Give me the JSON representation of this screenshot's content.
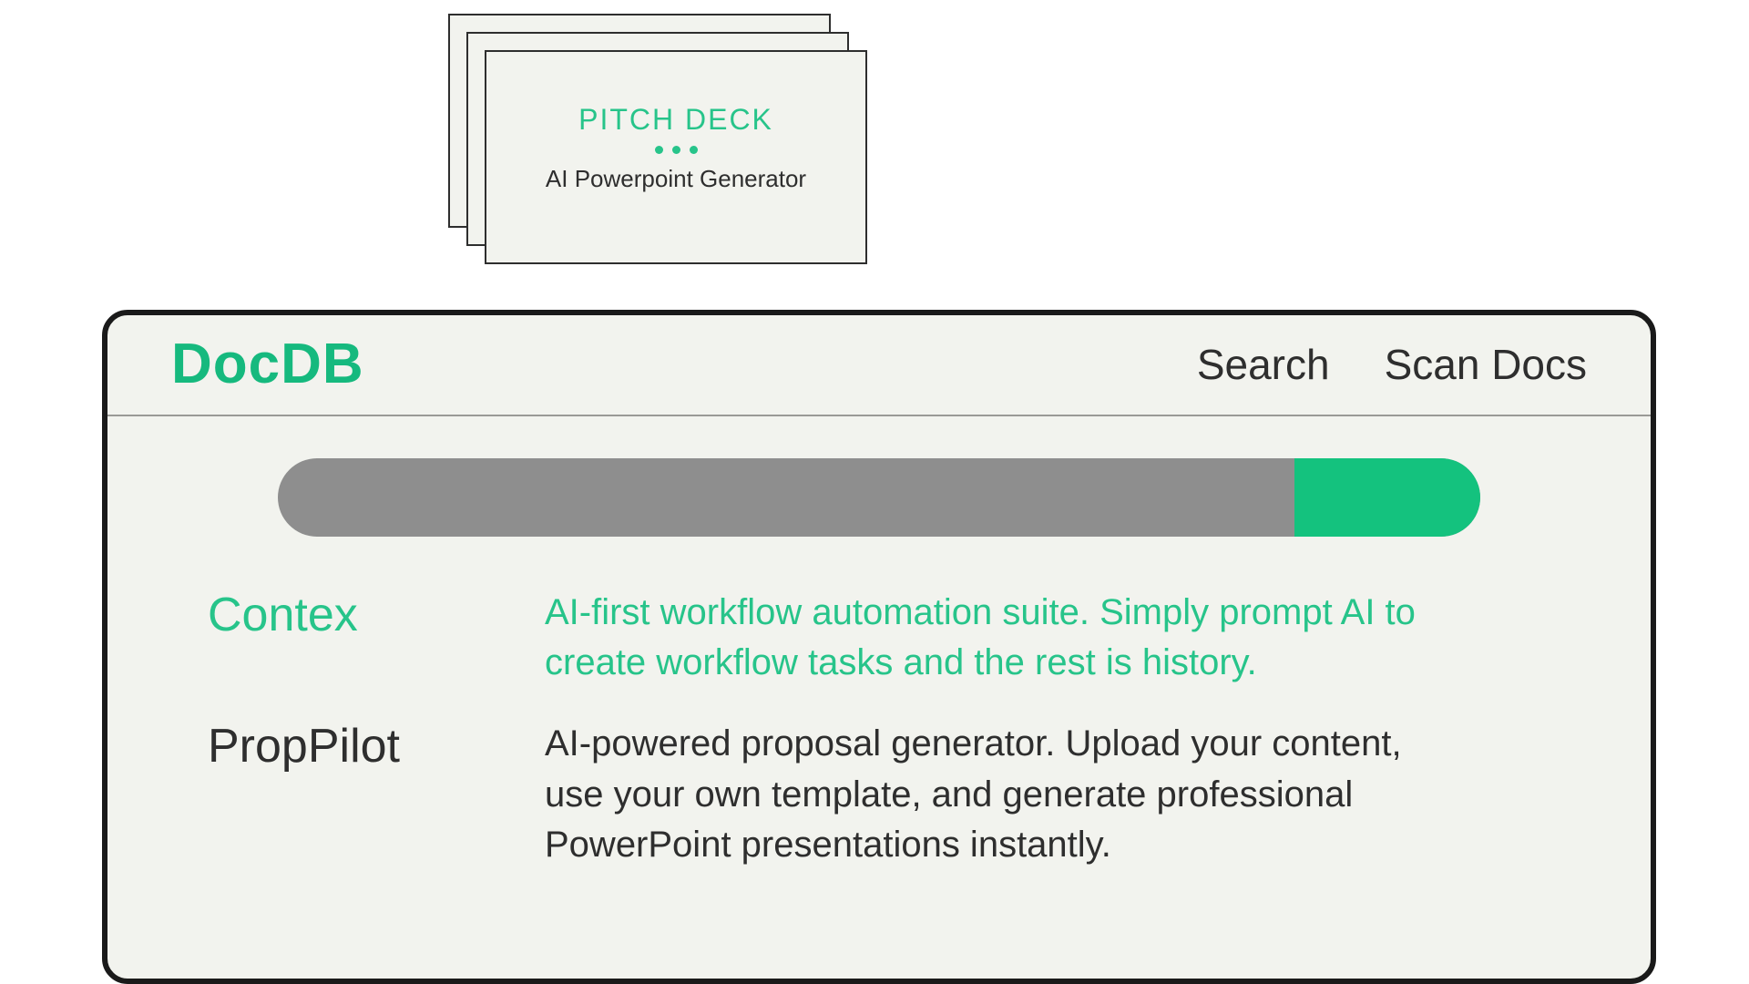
{
  "deck": {
    "title": "PITCH DECK",
    "subtitle": "AI Powerpoint Generator"
  },
  "app": {
    "brand": "DocDB",
    "nav": {
      "search": "Search",
      "scan": "Scan Docs"
    },
    "results": [
      {
        "name": "Contex",
        "desc": "AI-first workflow automation suite. Simply prompt AI to create workflow tasks and the rest is history."
      },
      {
        "name": "PropPilot",
        "desc": "AI-powered proposal generator. Upload your content, use your own template, and generate professional PowerPoint presentations instantly."
      }
    ]
  }
}
